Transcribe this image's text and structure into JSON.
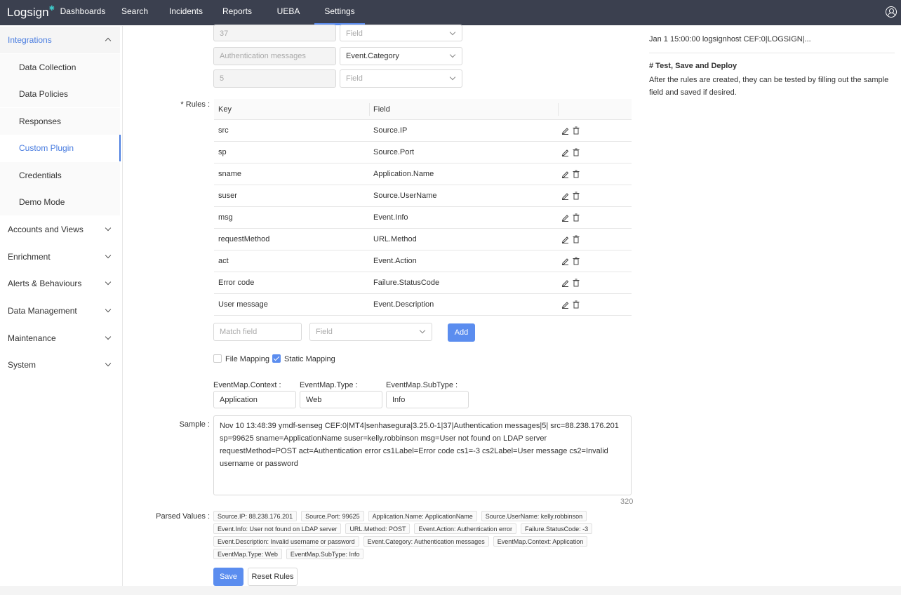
{
  "app": {
    "logo": "Logsign",
    "logo_mark": "✱"
  },
  "nav": {
    "items": [
      "Dashboards",
      "Search",
      "Incidents",
      "Reports",
      "UEBA",
      "Settings"
    ],
    "active": "Settings"
  },
  "sidebar": {
    "integrations": "Integrations",
    "sub_items": [
      "Data Collection",
      "Data Policies",
      "Responses",
      "Custom Plugin",
      "Credentials",
      "Demo Mode"
    ],
    "groups": [
      "Accounts and Views",
      "Enrichment",
      "Alerts & Behaviours",
      "Data Management",
      "Maintenance",
      "System"
    ]
  },
  "top_fields": {
    "row1_value": "37",
    "row1_select": "Field",
    "row2_value": "Authentication messages",
    "row2_select": "Event.Category",
    "row3_value": "5",
    "row3_select": "Field"
  },
  "rules": {
    "label": "* Rules :",
    "col_key": "Key",
    "col_field": "Field",
    "rows": [
      {
        "key": "src",
        "field": "Source.IP"
      },
      {
        "key": "sp",
        "field": "Source.Port"
      },
      {
        "key": "sname",
        "field": "Application.Name"
      },
      {
        "key": "suser",
        "field": "Source.UserName"
      },
      {
        "key": "msg",
        "field": "Event.Info"
      },
      {
        "key": "requestMethod",
        "field": "URL.Method"
      },
      {
        "key": "act",
        "field": "Event.Action"
      },
      {
        "key": "Error code",
        "field": "Failure.StatusCode"
      },
      {
        "key": "User message",
        "field": "Event.Description"
      }
    ],
    "match_placeholder": "Match field",
    "field_placeholder": "Field",
    "add_label": "Add"
  },
  "mapping": {
    "file_mapping": "File Mapping",
    "static_mapping": "Static Mapping",
    "context_label": "EventMap.Context :",
    "type_label": "EventMap.Type :",
    "subtype_label": "EventMap.SubType :",
    "context_value": "Application",
    "type_value": "Web",
    "subtype_value": "Info"
  },
  "sample": {
    "label": "Sample :",
    "text": "Nov 10 13:48:39 ymdf-senseg CEF:0|MT4|senhasegura|3.25.0-1|37|Authentication messages|5| src=88.238.176.201 sp=99625 sname=ApplicationName suser=kelly.robbinson msg=User not found on LDAP server requestMethod=POST act=Authentication error cs1Label=Error code cs1=-3 cs2Label=User message cs2=Invalid username or password",
    "count": "320"
  },
  "parsed": {
    "label": "Parsed Values :",
    "tags": [
      "Source.IP: 88.238.176.201",
      "Source.Port: 99625",
      "Application.Name: ApplicationName",
      "Source.UserName: kelly.robbinson",
      "Event.Info: User not found on LDAP server",
      "URL.Method: POST",
      "Event.Action: Authentication error",
      "Failure.StatusCode: -3",
      "Event.Description: Invalid username or password",
      "Event.Category: Authentication messages",
      "EventMap.Context: Application",
      "EventMap.Type: Web",
      "EventMap.SubType: Info"
    ]
  },
  "actions": {
    "save": "Save",
    "reset": "Reset Rules"
  },
  "right_panel": {
    "top_text": "Jan 1 15:00:00 logsignhost CEF:0|LOGSIGN|...",
    "heading": "# Test, Save and Deploy",
    "body": "After the rules are created, they can be tested by filling out the sample field and saved if desired."
  },
  "colors": {
    "nav_bg": "#3b404f",
    "accent": "#5b8def"
  }
}
